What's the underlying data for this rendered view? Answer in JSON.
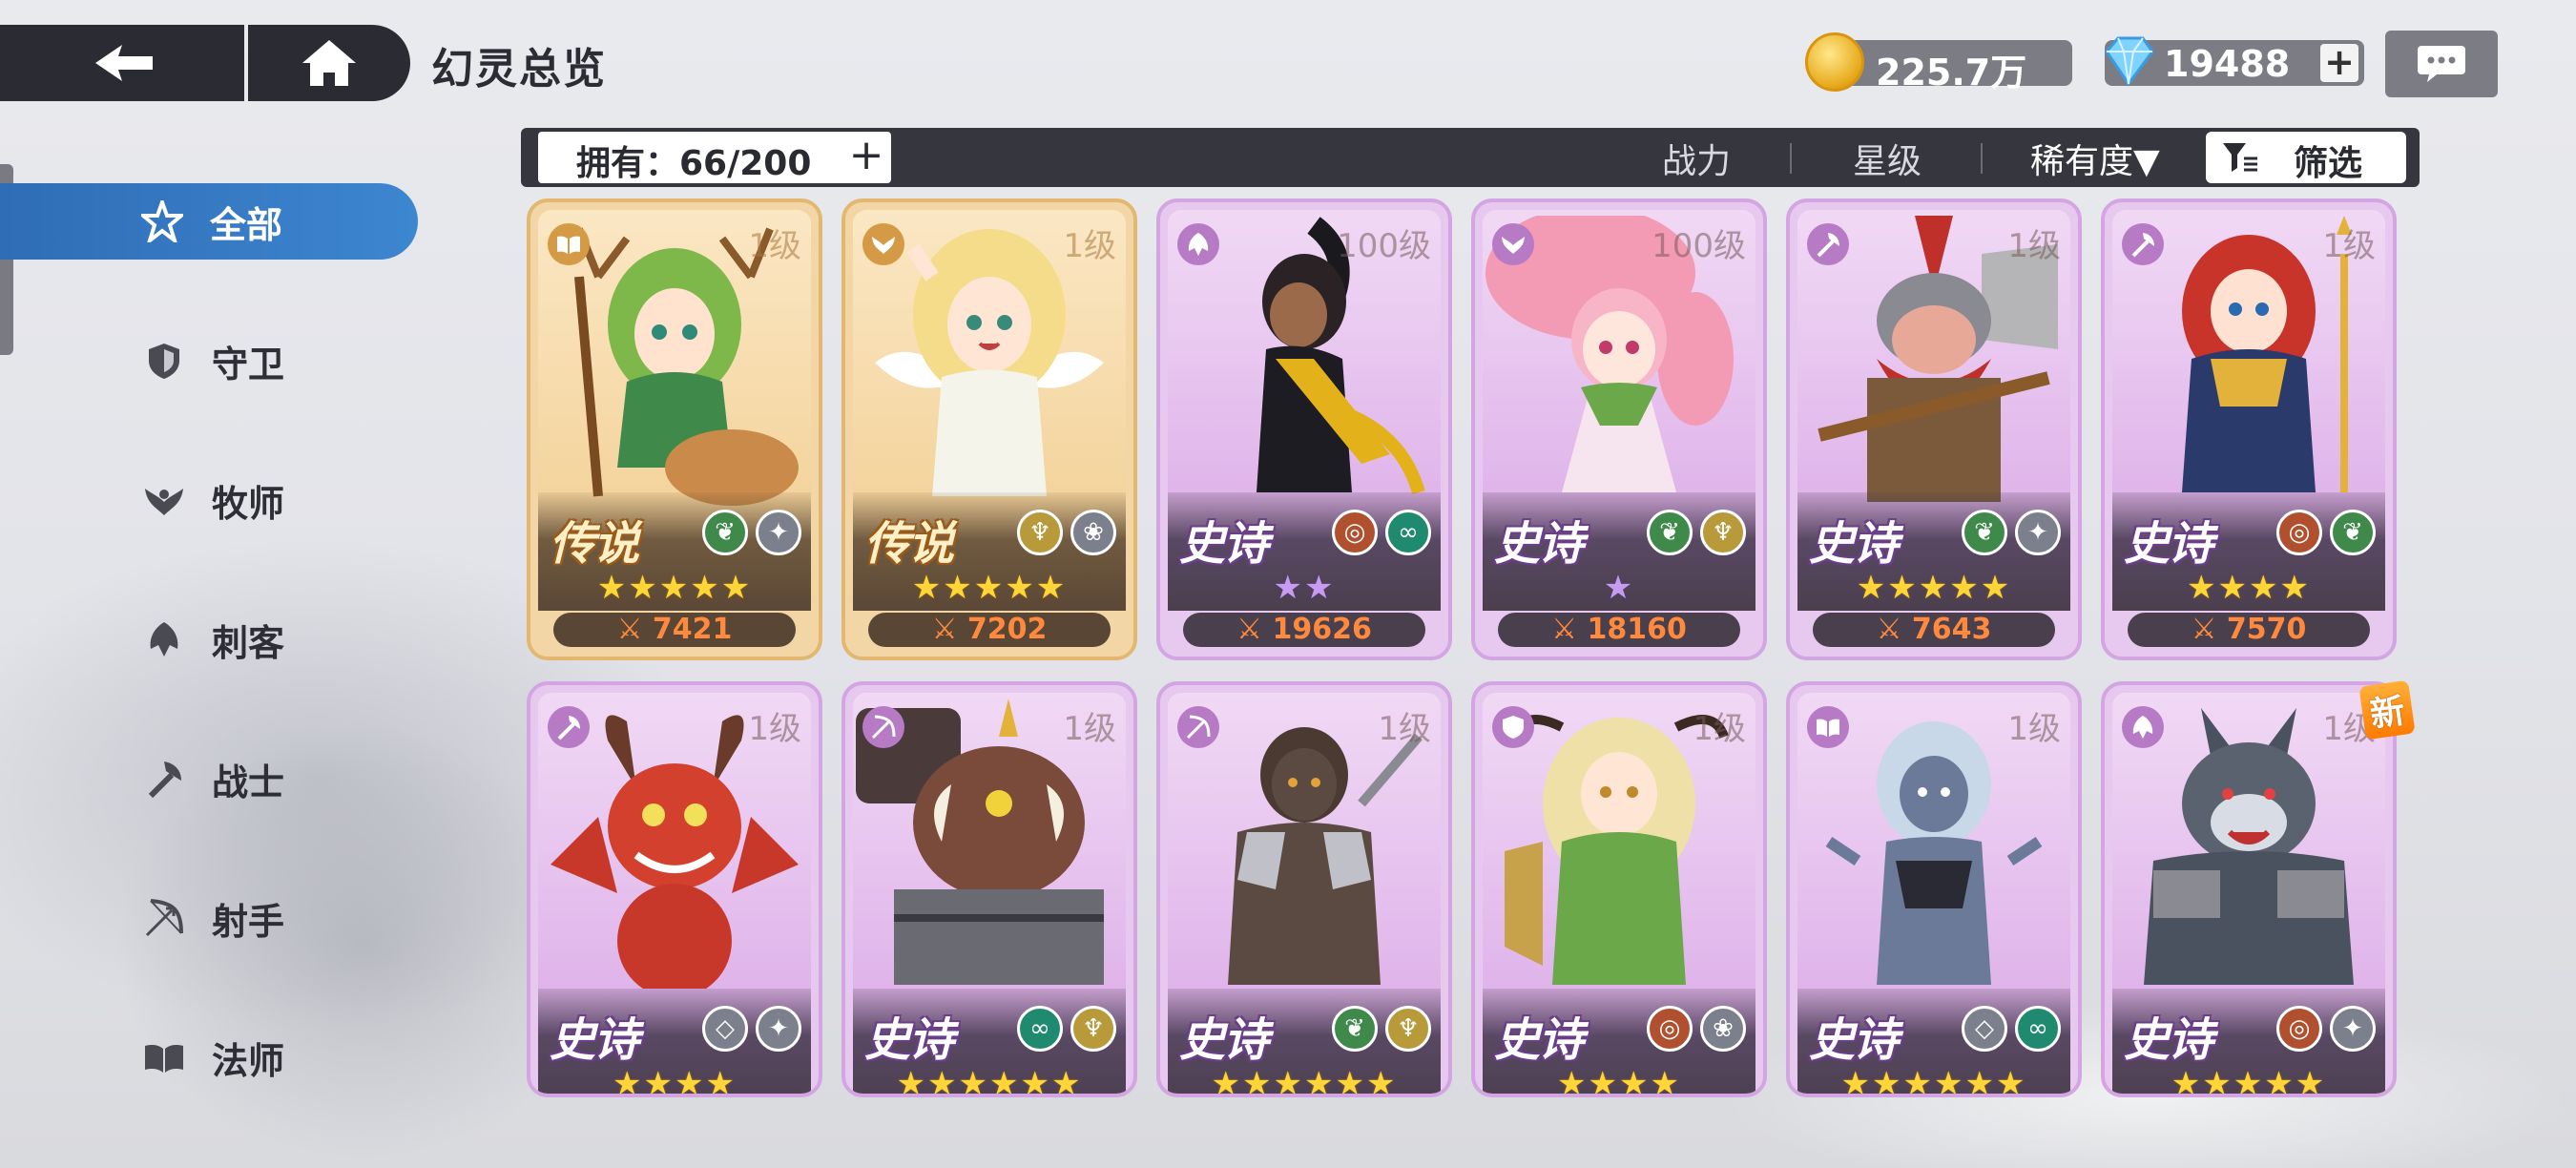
{
  "header": {
    "title": "幻灵总览"
  },
  "currency": {
    "gold": "225.7万",
    "gems": "19488",
    "gem_plus": "+"
  },
  "sidebar": {
    "items": [
      {
        "label": "全部",
        "icon": "all-star-icon"
      },
      {
        "label": "守卫",
        "icon": "shield-icon"
      },
      {
        "label": "牧师",
        "icon": "priest-wing-icon"
      },
      {
        "label": "刺客",
        "icon": "assassin-icon"
      },
      {
        "label": "战士",
        "icon": "axe-icon"
      },
      {
        "label": "射手",
        "icon": "bow-icon"
      },
      {
        "label": "法师",
        "icon": "book-icon"
      }
    ]
  },
  "filterbar": {
    "owned": "拥有：66/200",
    "owned_plus": "+",
    "sort_power": "战力",
    "sort_star": "星级",
    "sort_rarity": "稀有度▼",
    "filter": "筛选"
  },
  "cards": [
    {
      "level": "1级",
      "rarity": "传说",
      "stars": "★★★★★",
      "power": "7421",
      "tier": "legend",
      "class": "book"
    },
    {
      "level": "1级",
      "rarity": "传说",
      "stars": "★★★★★",
      "power": "7202",
      "tier": "legend",
      "class": "priest"
    },
    {
      "level": "100级",
      "rarity": "史诗",
      "stars": "★★",
      "power": "19626",
      "tier": "epic",
      "class": "assassin"
    },
    {
      "level": "100级",
      "rarity": "史诗",
      "stars": "★",
      "power": "18160",
      "tier": "epic",
      "class": "priest"
    },
    {
      "level": "1级",
      "rarity": "史诗",
      "stars": "★★★★★",
      "power": "7643",
      "tier": "epic",
      "class": "axe"
    },
    {
      "level": "1级",
      "rarity": "史诗",
      "stars": "★★★★",
      "power": "7570",
      "tier": "epic",
      "class": "axe"
    },
    {
      "level": "1级",
      "rarity": "史诗",
      "stars": "★★★★",
      "tier": "epic",
      "class": "axe"
    },
    {
      "level": "1级",
      "rarity": "史诗",
      "stars": "★★★★★★",
      "tier": "epic",
      "class": "bow"
    },
    {
      "level": "1级",
      "rarity": "史诗",
      "stars": "★★★★★★",
      "tier": "epic",
      "class": "bow"
    },
    {
      "level": "1级",
      "rarity": "史诗",
      "stars": "★★★★",
      "tier": "epic",
      "class": "shield"
    },
    {
      "level": "1级",
      "rarity": "史诗",
      "stars": "★★★★★★",
      "tier": "epic",
      "class": "book"
    },
    {
      "level": "1级",
      "rarity": "史诗",
      "stars": "★★★★★",
      "tier": "epic",
      "class": "assassin"
    }
  ],
  "badge": {
    "new": "新"
  },
  "colors": {
    "accent": "#3d86d0",
    "bar": "#36373e",
    "epic": "#e7c8ef",
    "legend": "#f3d6a6",
    "power": "#ff8a3d"
  }
}
